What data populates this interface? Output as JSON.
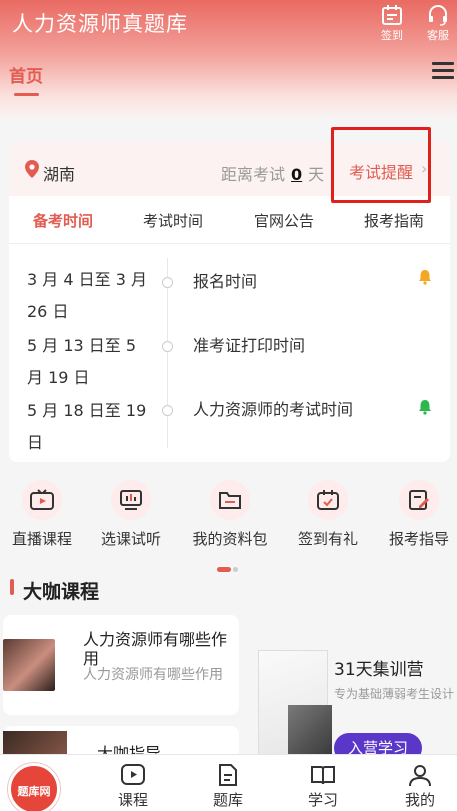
{
  "header": {
    "app_title": "人力资源师真题库",
    "checkin_label": "签到",
    "service_label": "客服",
    "tab_home": "首页"
  },
  "exam_card": {
    "location": "湖南",
    "countdown_prefix": "距离考试",
    "countdown_days": "0",
    "countdown_suffix": "天",
    "remind_label": "考试提醒",
    "remind_arrow": "›",
    "tabs": [
      "备考时间",
      "考试时间",
      "官网公告",
      "报考指南"
    ],
    "timeline": [
      {
        "date": "3 月 4 日至 3 月 26 日",
        "label": "报名时间",
        "bell_color": "#f5a623"
      },
      {
        "date": "5 月 13 日至 5 月 19 日",
        "label": "准考证打印时间",
        "bell_color": null
      },
      {
        "date": "5 月 18 日至 19 日",
        "label": "人力资源师的考试时间",
        "bell_color": "#2db84d"
      }
    ]
  },
  "quick_links": [
    {
      "label": "直播课程",
      "icon": "tv-play-icon"
    },
    {
      "label": "选课试听",
      "icon": "board-icon"
    },
    {
      "label": "我的资料包",
      "icon": "folder-icon"
    },
    {
      "label": "签到有礼",
      "icon": "calendar-check-icon"
    },
    {
      "label": "报考指导",
      "icon": "guide-edit-icon"
    }
  ],
  "section": {
    "title": "大咖课程"
  },
  "courses": [
    {
      "title": "人力资源师有哪些作用",
      "subtitle": "人力资源师有哪些作用"
    },
    {
      "title": "大咖指导",
      "subtitle": ""
    }
  ],
  "promo": {
    "title": "31天集训营",
    "subtitle": "专为基础薄弱考生设计",
    "button": "入营学习"
  },
  "bottom_nav": {
    "logo_text": "题库网",
    "items": [
      "课程",
      "题库",
      "学习",
      "我的"
    ]
  },
  "colors": {
    "accent": "#e25c52",
    "highlight_box": "#e0201b",
    "promo_button": "#5a36c9"
  }
}
